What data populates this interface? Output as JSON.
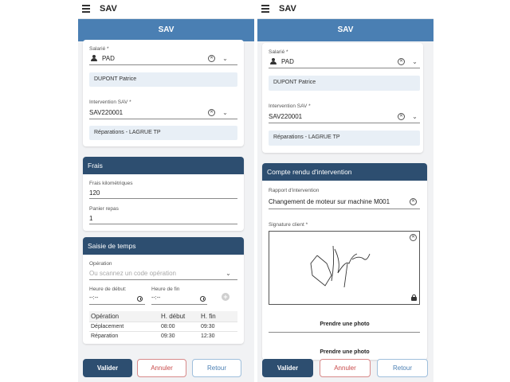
{
  "app": {
    "title": "SAV",
    "section_title": "SAV"
  },
  "left": {
    "salarie": {
      "label": "Salarié *",
      "value": "PAD",
      "name": "DUPONT Patrice"
    },
    "intervention": {
      "label": "Intervention SAV *",
      "value": "SAV220001",
      "detail": "Réparations - LAGRUE TP"
    },
    "frais": {
      "title": "Frais",
      "km_label": "Frais kilométriques",
      "km_value": "120",
      "panier_label": "Panier repas",
      "panier_value": "1"
    },
    "saisie": {
      "title": "Saisie de temps",
      "operation_label": "Opération",
      "operation_placeholder": "Ou scannez un code opération",
      "debut_label": "Heure de début:",
      "debut_value": "--:--",
      "fin_label": "Heure de fin",
      "fin_value": "--:--",
      "table": {
        "headers": [
          "Opération",
          "H. début",
          "H. fin"
        ],
        "rows": [
          [
            "Déplacement",
            "08:00",
            "09:30"
          ],
          [
            "Réparation",
            "09:30",
            "12:30"
          ]
        ]
      }
    },
    "buttons": {
      "validate": "Valider",
      "cancel": "Annuler",
      "back": "Retour"
    }
  },
  "right": {
    "salarie": {
      "label": "Salarié *",
      "value": "PAD",
      "name": "DUPONT Patrice"
    },
    "intervention": {
      "label": "Intervention SAV *",
      "value": "SAV220001",
      "detail": "Réparations - LAGRUE TP"
    },
    "compte_rendu": {
      "title": "Compte rendu d'intervention",
      "rapport_label": "Rapport d'intervention",
      "rapport_value": "Changement de moteur sur machine M001",
      "signature_label": "Signature client *"
    },
    "photo_label_1": "Prendre une photo",
    "photo_label_2": "Prendre une photo",
    "buttons": {
      "validate": "Valider",
      "cancel": "Annuler",
      "back": "Retour"
    }
  },
  "colors": {
    "accent": "#4a7fb3",
    "header_dark": "#2d4e70",
    "cancel": "#c94a4a",
    "info_bg": "#e8eff6"
  },
  "icons": [
    "menu-icon",
    "person-icon",
    "clear-icon",
    "chevron-down-icon",
    "clock-icon",
    "add-icon",
    "lock-icon"
  ]
}
